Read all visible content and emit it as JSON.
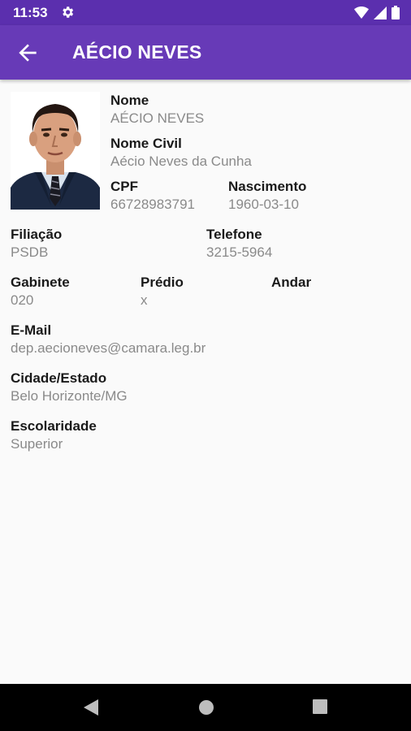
{
  "status_bar": {
    "time": "11:53",
    "icons": [
      "gear-icon",
      "wifi-icon",
      "signal-icon",
      "battery-icon"
    ]
  },
  "app_bar": {
    "title": "AÉCIO NEVES",
    "back_icon": "arrow-left-icon",
    "color": "#673ab7"
  },
  "profile": {
    "nome_label": "Nome",
    "nome_value": "AÉCIO NEVES",
    "nome_civil_label": "Nome Civil",
    "nome_civil_value": "Aécio Neves da Cunha",
    "cpf_label": "CPF",
    "cpf_value": "66728983791",
    "nascimento_label": "Nascimento",
    "nascimento_value": "1960-03-10",
    "filiacao_label": "Filiação",
    "filiacao_value": "PSDB",
    "telefone_label": "Telefone",
    "telefone_value": "3215-5964",
    "gabinete_label": "Gabinete",
    "gabinete_value": "020",
    "predio_label": "Prédio",
    "predio_value": "x",
    "andar_label": "Andar",
    "andar_value": "",
    "email_label": "E-Mail",
    "email_value": "dep.aecioneves@camara.leg.br",
    "cidade_label": "Cidade/Estado",
    "cidade_value": "Belo Horizonte/MG",
    "escolaridade_label": "Escolaridade",
    "escolaridade_value": "Superior"
  },
  "nav_bar": {
    "buttons": [
      "back-triangle-icon",
      "home-circle-icon",
      "recents-square-icon"
    ]
  }
}
